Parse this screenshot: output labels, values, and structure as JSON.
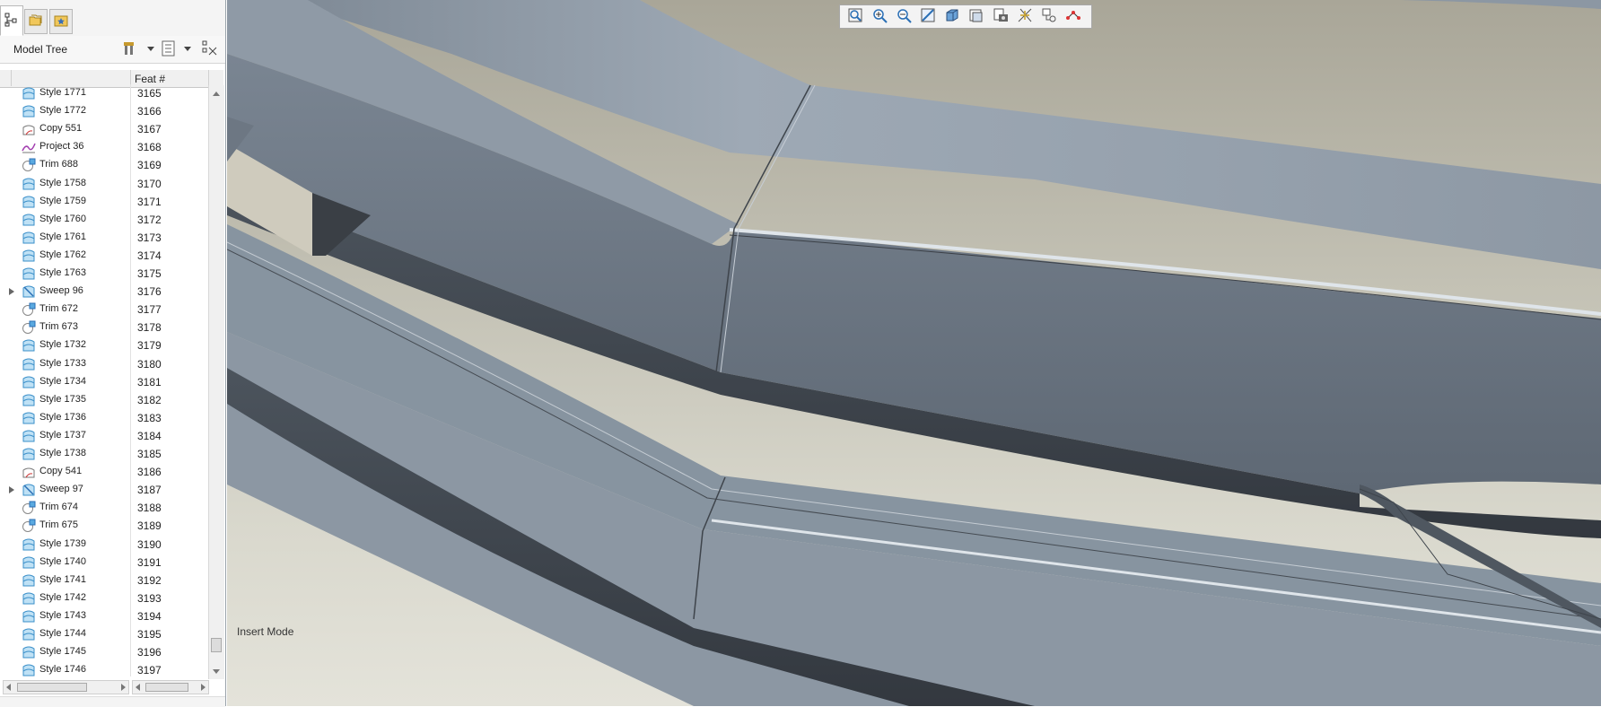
{
  "panel": {
    "tabs": [
      {
        "name": "model-tree-tab-icon"
      },
      {
        "name": "folder-browser-tab-icon"
      },
      {
        "name": "favorites-tab-icon"
      }
    ],
    "title": "Model Tree",
    "header_icons": [
      "settings-icon",
      "tree-filters-icon",
      "show-hide-icon"
    ],
    "column_header": "Feat #",
    "rows": [
      {
        "label": "Style 1771",
        "num": "3165",
        "icon": "style",
        "expandable": false
      },
      {
        "label": "Style 1772",
        "num": "3166",
        "icon": "style",
        "expandable": false
      },
      {
        "label": "Copy 551",
        "num": "3167",
        "icon": "copy",
        "expandable": false
      },
      {
        "label": "Project 36",
        "num": "3168",
        "icon": "project",
        "expandable": false
      },
      {
        "label": "Trim 688",
        "num": "3169",
        "icon": "trim",
        "expandable": false
      },
      {
        "label": "Style 1758",
        "num": "3170",
        "icon": "style",
        "expandable": false
      },
      {
        "label": "Style 1759",
        "num": "3171",
        "icon": "style",
        "expandable": false
      },
      {
        "label": "Style 1760",
        "num": "3172",
        "icon": "style",
        "expandable": false
      },
      {
        "label": "Style 1761",
        "num": "3173",
        "icon": "style",
        "expandable": false
      },
      {
        "label": "Style 1762",
        "num": "3174",
        "icon": "style",
        "expandable": false
      },
      {
        "label": "Style 1763",
        "num": "3175",
        "icon": "style",
        "expandable": false
      },
      {
        "label": "Sweep 96",
        "num": "3176",
        "icon": "sweep",
        "expandable": true
      },
      {
        "label": "Trim 672",
        "num": "3177",
        "icon": "trim",
        "expandable": false
      },
      {
        "label": "Trim 673",
        "num": "3178",
        "icon": "trim",
        "expandable": false
      },
      {
        "label": "Style 1732",
        "num": "3179",
        "icon": "style",
        "expandable": false
      },
      {
        "label": "Style 1733",
        "num": "3180",
        "icon": "style",
        "expandable": false
      },
      {
        "label": "Style 1734",
        "num": "3181",
        "icon": "style",
        "expandable": false
      },
      {
        "label": "Style 1735",
        "num": "3182",
        "icon": "style",
        "expandable": false
      },
      {
        "label": "Style 1736",
        "num": "3183",
        "icon": "style",
        "expandable": false
      },
      {
        "label": "Style 1737",
        "num": "3184",
        "icon": "style",
        "expandable": false
      },
      {
        "label": "Style 1738",
        "num": "3185",
        "icon": "style",
        "expandable": false
      },
      {
        "label": "Copy 541",
        "num": "3186",
        "icon": "copy",
        "expandable": false
      },
      {
        "label": "Sweep 97",
        "num": "3187",
        "icon": "sweep",
        "expandable": true
      },
      {
        "label": "Trim 674",
        "num": "3188",
        "icon": "trim",
        "expandable": false
      },
      {
        "label": "Trim 675",
        "num": "3189",
        "icon": "trim",
        "expandable": false
      },
      {
        "label": "Style 1739",
        "num": "3190",
        "icon": "style",
        "expandable": false
      },
      {
        "label": "Style 1740",
        "num": "3191",
        "icon": "style",
        "expandable": false
      },
      {
        "label": "Style 1741",
        "num": "3192",
        "icon": "style",
        "expandable": false
      },
      {
        "label": "Style 1742",
        "num": "3193",
        "icon": "style",
        "expandable": false
      },
      {
        "label": "Style 1743",
        "num": "3194",
        "icon": "style",
        "expandable": false
      },
      {
        "label": "Style 1744",
        "num": "3195",
        "icon": "style",
        "expandable": false
      },
      {
        "label": "Style 1745",
        "num": "3196",
        "icon": "style",
        "expandable": false
      },
      {
        "label": "Style 1746",
        "num": "3197",
        "icon": "style",
        "expandable": false
      }
    ]
  },
  "viewport": {
    "mode_label": "Insert Mode",
    "toolbar": [
      "refit-icon",
      "zoom-in-icon",
      "zoom-out-icon",
      "repaint-icon",
      "display-style-icon",
      "saved-views-icon",
      "view-manager-icon",
      "datum-display-icon",
      "annotation-display-icon",
      "spin-center-icon"
    ]
  },
  "colors": {
    "panel_bg": "#ffffff",
    "style_icon": "#4aa3d8",
    "model_surface": "#8b96a3",
    "background_top": "#a9a698",
    "background_bottom": "#e4e3da"
  }
}
